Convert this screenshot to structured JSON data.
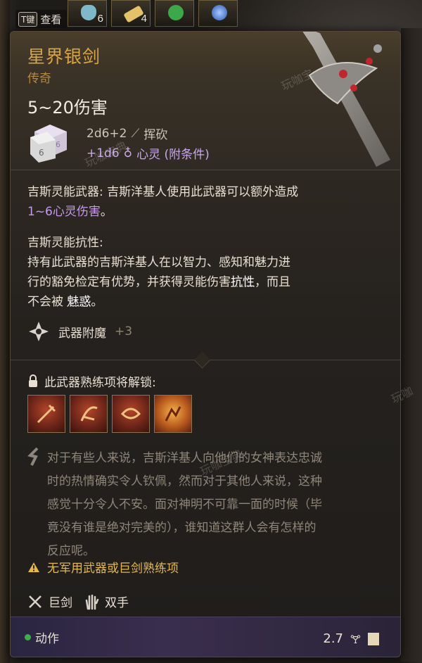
{
  "hotbar": {
    "slots": [
      {
        "icon": "potion-icon",
        "count": "6",
        "color": "#7fb8c8"
      },
      {
        "icon": "scroll-icon",
        "count": "4",
        "color": "#e3c26a"
      },
      {
        "icon": "green-gem-icon",
        "count": "",
        "color": "#3ca84a"
      },
      {
        "icon": "blue-orb-icon",
        "count": "",
        "color": "#4a7fd0"
      }
    ]
  },
  "keyhint": {
    "key": "T键",
    "label": "查看"
  },
  "item": {
    "name": "星界银剑",
    "rarity": "传奇",
    "damage_total": "5~20伤害",
    "damage_base": "2d6+2",
    "damage_base_type": "挥砍",
    "damage_extra": "+1d6",
    "damage_extra_type": "心灵 (附条件)"
  },
  "passive1": {
    "title": "吉斯灵能武器:",
    "text": " 吉斯洋基人使用此武器可以额外造成",
    "highlight": "1~6心灵伤害",
    "tail": "。"
  },
  "passive2": {
    "title": "吉斯灵能抗性:",
    "line1": "持有此武器的吉斯洋基人在以智力、感知和魅力进",
    "line2a": "行的豁免检定有优势，并获得灵能伤害",
    "line2b": "抗性",
    "line2c": "，而且",
    "line3a": "不会被 ",
    "line3b": "魅惑",
    "line3c": "。"
  },
  "enchantment": {
    "label": "武器附魔",
    "value": "+3"
  },
  "proficiency": {
    "title": "此武器熟练项将解锁:",
    "actions": [
      {
        "icon": "pommel-strike-icon"
      },
      {
        "icon": "lacerate-icon"
      },
      {
        "icon": "cleave-icon"
      },
      {
        "icon": "rush-attack-icon"
      }
    ]
  },
  "flavor": {
    "lines": [
      "对于有些人来说，吉斯洋基人向他们的女神表达忠诚",
      "时的热情确实令人钦佩，然而对于其他人来说，这种",
      "感觉十分令人不安。面对神明不可靠一面的时候（毕",
      "竟没有谁是绝对完美的），谁知道这群人会有怎样的",
      "反应呢。"
    ]
  },
  "warning": {
    "text": "无军用武器或巨剑熟练项"
  },
  "properties": [
    {
      "icon": "greatsword-icon",
      "label": "巨剑"
    },
    {
      "icon": "two-handed-icon",
      "label": "双手"
    }
  ],
  "footer": {
    "action_label": "动作",
    "weight": "2.7"
  },
  "watermarks": [
    "玩咖宝",
    "玩咖宝典",
    "玩咖宝典",
    "玩咖"
  ]
}
